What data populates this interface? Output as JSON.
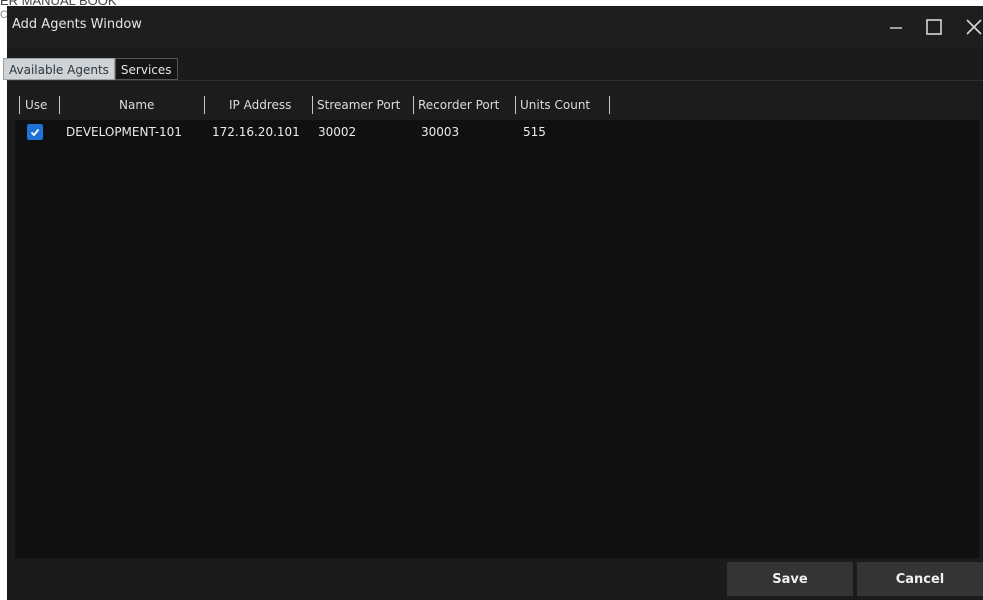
{
  "background_doc": {
    "header": "ER MANUAL BOOK",
    "subtext": "C"
  },
  "window": {
    "title": "Add Agents Window"
  },
  "window_controls": {
    "minimize": "minimize-icon",
    "maximize": "maximize-icon",
    "close": "close-icon"
  },
  "tabs": [
    {
      "label": "Available Agents",
      "active": true
    },
    {
      "label": "Services",
      "active": false
    }
  ],
  "table": {
    "columns": [
      "Use",
      "Name",
      "IP Address",
      "Streamer Port",
      "Recorder Port",
      "Units Count"
    ],
    "rows": [
      {
        "use": true,
        "name": "DEVELOPMENT-101",
        "ip": "172.16.20.101",
        "streamer_port": "30002",
        "recorder_port": "30003",
        "units_count": "515"
      }
    ]
  },
  "buttons": {
    "save": "Save",
    "cancel": "Cancel"
  },
  "colors": {
    "window_bg": "#1b1b1b",
    "grid_bg": "#101010",
    "checkbox": "#1e73d8",
    "active_tab": "#cfd3d6"
  }
}
